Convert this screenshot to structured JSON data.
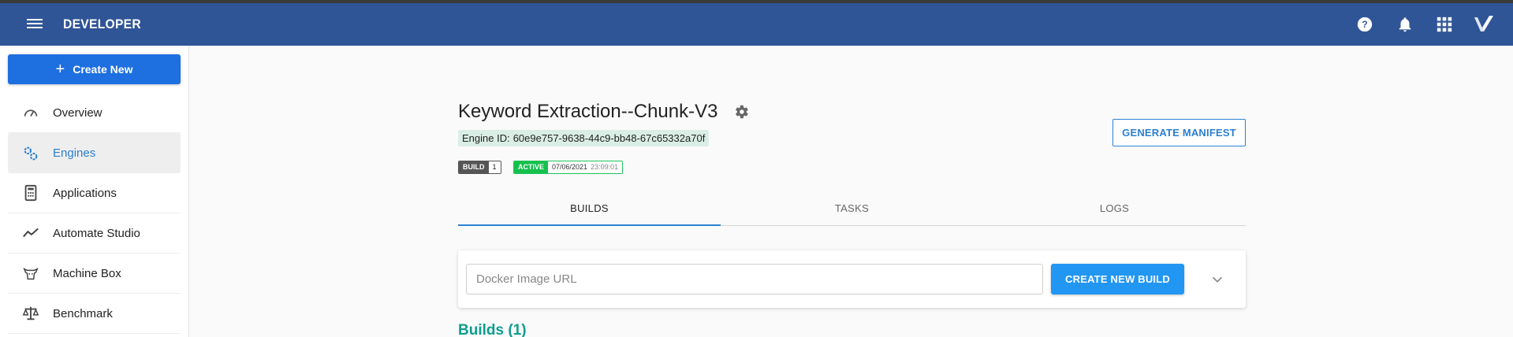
{
  "appbar": {
    "title": "DEVELOPER",
    "icons": [
      "menu-icon",
      "help-icon",
      "bell-icon",
      "apps-grid-icon",
      "veritone-logo-icon"
    ],
    "bg_color": "#2f5597"
  },
  "sidebar": {
    "create_button_label": "Create New",
    "items": [
      {
        "label": "Overview",
        "icon": "gauge-icon",
        "active": false
      },
      {
        "label": "Engines",
        "icon": "gears-icon",
        "active": true
      },
      {
        "label": "Applications",
        "icon": "calculator-icon",
        "active": false
      },
      {
        "label": "Automate Studio",
        "icon": "trend-line-icon",
        "active": false
      },
      {
        "label": "Machine Box",
        "icon": "cow-icon",
        "active": false
      },
      {
        "label": "Benchmark",
        "icon": "scale-icon",
        "active": false
      }
    ]
  },
  "engine": {
    "title": "Keyword Extraction--Chunk-V3",
    "id_label": "Engine ID:",
    "id_value": "60e9e757-9638-44c9-bb48-67c65332a70f",
    "build_badge_label": "BUILD",
    "build_badge_value": "1",
    "status_badge_label": "ACTIVE",
    "status_date": "07/06/2021",
    "status_time": "23:09:01",
    "generate_manifest_label": "GENERATE MANIFEST"
  },
  "tabs": [
    {
      "label": "BUILDS",
      "active": true
    },
    {
      "label": "TASKS",
      "active": false
    },
    {
      "label": "LOGS",
      "active": false
    }
  ],
  "build_form": {
    "docker_placeholder": "Docker Image URL",
    "docker_value": "",
    "create_build_label": "CREATE NEW BUILD"
  },
  "builds_heading": "Builds (1)",
  "colors": {
    "accent": "#2196f3",
    "active_green": "#16c04c",
    "heading_teal": "#0f9d8f"
  }
}
